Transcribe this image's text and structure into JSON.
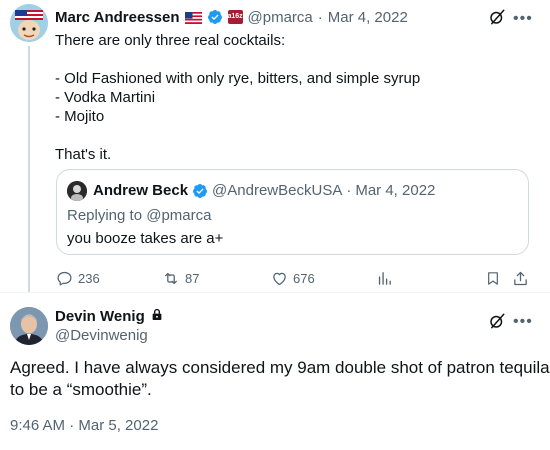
{
  "tweet": {
    "author_name": "Marc Andreessen",
    "affiliate_badge": "a16z",
    "handle": "@pmarca",
    "separator": "·",
    "date": "Mar 4, 2022",
    "lines": [
      "There are only three real cocktails:",
      "",
      "- Old Fashioned with only rye, bitters, and simple syrup",
      "- Vodka Martini",
      "- Mojito",
      "",
      "That's it."
    ],
    "quote": {
      "author_name": "Andrew Beck",
      "handle": "@AndrewBeckUSA",
      "separator": "·",
      "date": "Mar 4, 2022",
      "replying_to": "Replying to @pmarca",
      "text": "you booze takes are a+"
    },
    "actions": {
      "replies": "236",
      "retweets": "87",
      "likes": "676"
    }
  },
  "reply": {
    "author_name": "Devin Wenig",
    "handle": "@Devinwenig",
    "lines": [
      "Agreed.  I have always considered my 9am double shot of patron tequila",
      "to be a “smoothie”."
    ],
    "timestamp": "9:46 AM · Mar 5, 2022"
  },
  "colors": {
    "text": "#0f1419",
    "muted": "#536471",
    "verified": "#1d9bf0",
    "border": "#cfd9de"
  },
  "icons": [
    "reply-icon",
    "retweet-icon",
    "like-icon",
    "views-icon",
    "bookmark-icon",
    "share-icon",
    "grok-icon",
    "more-icon",
    "verified-badge-icon",
    "lock-icon"
  ]
}
